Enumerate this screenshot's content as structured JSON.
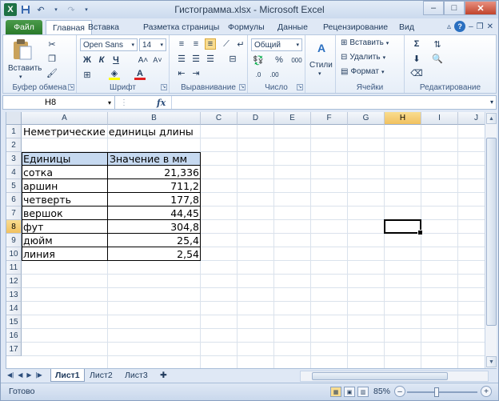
{
  "window": {
    "title": "Гистограмма.xlsx - Microsoft Excel",
    "logo": "X"
  },
  "qat": {
    "save_icon": "save-icon",
    "undo_icon": "undo-icon",
    "redo_icon": "redo-icon"
  },
  "tabs": [
    "Файл",
    "Главная",
    "Вставка",
    "Разметка страницы",
    "Формулы",
    "Данные",
    "Рецензирование",
    "Вид"
  ],
  "ribbon": {
    "clipboard": {
      "label": "Буфер обмена",
      "paste": "Вставить"
    },
    "font": {
      "label": "Шрифт",
      "font_name": "Open Sans",
      "font_size": "14",
      "bold": "Ж",
      "italic": "К",
      "underline": "Ч",
      "grow": "A˄",
      "shrink": "A˅"
    },
    "alignment": {
      "label": "Выравнивание"
    },
    "number": {
      "label": "Число",
      "format": "Общий",
      "percent": "%",
      "thousands": "000"
    },
    "styles": {
      "label": "Стили",
      "button": "Стили"
    },
    "cells": {
      "label": "Ячейки",
      "insert": "Вставить",
      "delete": "Удалить",
      "format": "Формат"
    },
    "editing": {
      "label": "Редактирование",
      "sum": "Σ"
    }
  },
  "formula_bar": {
    "name_box": "H8",
    "fx": "fx",
    "formula": ""
  },
  "columns": [
    "A",
    "B",
    "C",
    "D",
    "E",
    "F",
    "G",
    "H",
    "I",
    "J"
  ],
  "selected_column": "H",
  "rows": [
    "1",
    "2",
    "3",
    "4",
    "5",
    "6",
    "7",
    "8",
    "9",
    "10",
    "11",
    "12",
    "13",
    "14",
    "15",
    "16",
    "17"
  ],
  "selected_row": "8",
  "sheet": {
    "title": "Неметрические единицы длины",
    "table_headers": [
      "Единицы",
      "Значение в мм"
    ],
    "table_rows": [
      {
        "unit": "сотка",
        "value": "21,336"
      },
      {
        "unit": "аршин",
        "value": "711,2"
      },
      {
        "unit": "четверть",
        "value": "177,8"
      },
      {
        "unit": "вершок",
        "value": "44,45"
      },
      {
        "unit": "фут",
        "value": "304,8"
      },
      {
        "unit": "дюйм",
        "value": "25,4"
      },
      {
        "unit": "линия",
        "value": "2,54"
      }
    ]
  },
  "sheet_tabs": [
    "Лист1",
    "Лист2",
    "Лист3"
  ],
  "active_sheet": "Лист1",
  "status": {
    "ready": "Готово",
    "zoom": "85%",
    "zoom_level_percent": 85
  },
  "colors": {
    "header_fill": "#c6d9f0",
    "selected_header": "#f1c15f",
    "file_tab": "#2a7a2a"
  }
}
